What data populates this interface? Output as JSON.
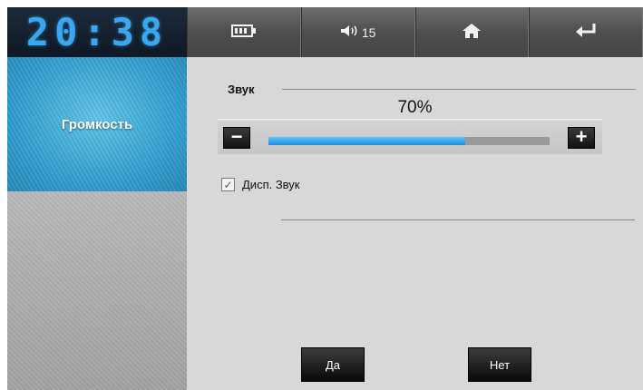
{
  "clock": {
    "time": "20:38"
  },
  "sidebar": {
    "items": [
      {
        "label": "Громкость",
        "active": true
      }
    ]
  },
  "topbar": {
    "battery_icon": "battery-icon",
    "volume_icon": "speaker-icon",
    "volume_value": "15",
    "home_icon": "home-icon",
    "back_icon": "back-arrow-icon"
  },
  "sound": {
    "title": "Звук",
    "percent_label": "70%",
    "level": 0.7,
    "minus_label": "−",
    "plus_label": "+",
    "display_sound_label": "Дисп. Звук",
    "display_sound_checked": true
  },
  "actions": {
    "yes_label": "Да",
    "no_label": "Нет"
  },
  "colors": {
    "accent": "#2f9ccd",
    "slider_fill": "#1e8fe0",
    "clock_digits": "#3aa8f0"
  }
}
